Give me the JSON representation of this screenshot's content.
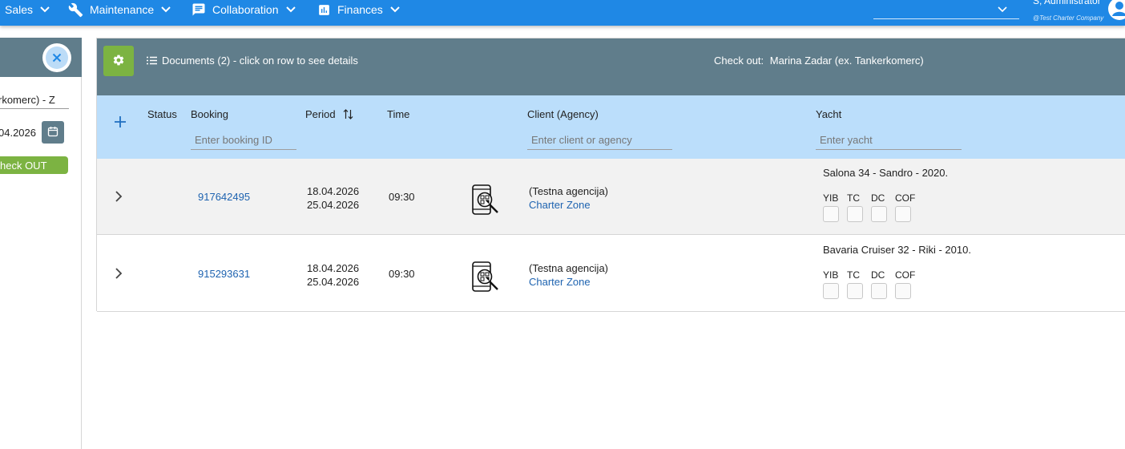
{
  "nav": {
    "items": [
      {
        "label": "Sales",
        "icon": "none"
      },
      {
        "label": "Maintenance",
        "icon": "wrench-icon"
      },
      {
        "label": "Collaboration",
        "icon": "chat-icon"
      },
      {
        "label": "Finances",
        "icon": "bar-chart-icon"
      }
    ],
    "user_name": "S, Administrator",
    "user_company": "@Test Charter Company"
  },
  "left_panel": {
    "location_value": "rkomerc) - Z",
    "date_value": "04.2026",
    "checkout_button": "heck OUT"
  },
  "main": {
    "documents_label": "Documents (2) - click on row to see details",
    "checkout_label": "Check out:",
    "checkout_value": "Marina Zadar (ex. Tankerkomerc)",
    "columns": {
      "status": "Status",
      "booking": "Booking",
      "period": "Period",
      "time": "Time",
      "client": "Client (Agency)",
      "yacht": "Yacht"
    },
    "filters": {
      "booking_placeholder": "Enter booking ID",
      "client_placeholder": "Enter client or agency",
      "yacht_placeholder": "Enter yacht"
    },
    "rows": [
      {
        "booking": "917642495",
        "period_start": "18.04.2026",
        "period_end": "25.04.2026",
        "time": "09:30",
        "client": "(Testna agencija)",
        "agency": "Charter Zone",
        "yacht": "Salona 34 - Sandro - 2020.",
        "docs": [
          "YIB",
          "TC",
          "DC",
          "COF"
        ]
      },
      {
        "booking": "915293631",
        "period_start": "18.04.2026",
        "period_end": "25.04.2026",
        "time": "09:30",
        "client": "(Testna agencija)",
        "agency": "Charter Zone",
        "yacht": "Bavaria Cruiser 32 - Riki - 2010.",
        "docs": [
          "YIB",
          "TC",
          "DC",
          "COF"
        ]
      }
    ]
  },
  "colors": {
    "topbar": "#1f88e5",
    "header": "#607d8b",
    "filter_row": "#bbdefb",
    "green": "#7cb342",
    "link": "#1e63b0"
  }
}
